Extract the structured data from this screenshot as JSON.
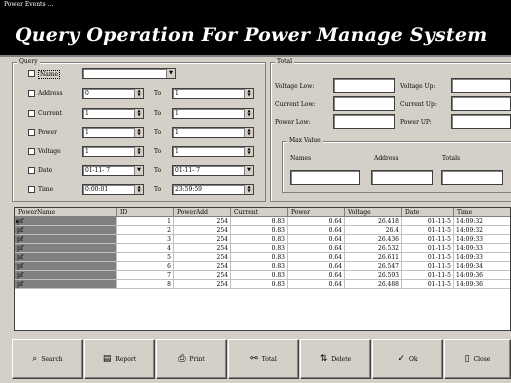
{
  "window": {
    "title": "Power Events ..."
  },
  "banner": {
    "title": "Query Operation For Power Manage System"
  },
  "query": {
    "caption": "Query",
    "to_label": "To",
    "rows": [
      {
        "label": "Name",
        "from": "",
        "to": null
      },
      {
        "label": "Address",
        "from": "0",
        "to": "1"
      },
      {
        "label": "Current",
        "from": "1",
        "to": "1"
      },
      {
        "label": "Power",
        "from": "1",
        "to": "1"
      },
      {
        "label": "Voltage",
        "from": "1",
        "to": "1"
      },
      {
        "label": "Date",
        "from": "01-11- 7",
        "to": "01-11- 7"
      },
      {
        "label": "Time",
        "from": "0:00:01",
        "to": "23:59:59"
      }
    ]
  },
  "total": {
    "caption": "Total",
    "voltage_low_label": "Voltage Low:",
    "current_low_label": "Current Low:",
    "power_low_label": "Power Low:",
    "voltage_up_label": "Voltage Up:",
    "current_up_label": "Current Up:",
    "power_up_label": "Power UP:",
    "max_value": {
      "caption": "Max Value",
      "names_label": "Names",
      "address_label": "Address",
      "totals_label": "Totals"
    }
  },
  "grid": {
    "columns": [
      "PowerName",
      "ID",
      "PowerAdd",
      "Current",
      "Power",
      "Voltage",
      "Date",
      "Time"
    ],
    "rows": [
      [
        "pf",
        "1",
        "254",
        "0.83",
        "0.64",
        "26.418",
        "01-11-5",
        "14:09:32"
      ],
      [
        "pf",
        "2",
        "254",
        "0.83",
        "0.64",
        "26.4",
        "01-11-5",
        "14:09:32"
      ],
      [
        "pf",
        "3",
        "254",
        "0.83",
        "0.64",
        "26.436",
        "01-11-5",
        "14:09:33"
      ],
      [
        "pf",
        "4",
        "254",
        "0.83",
        "0.64",
        "26.532",
        "01-11-5",
        "14:09:33"
      ],
      [
        "pf",
        "5",
        "254",
        "0.83",
        "0.64",
        "26.611",
        "01-11-5",
        "14:09:33"
      ],
      [
        "pf",
        "6",
        "254",
        "0.83",
        "0.64",
        "26.547",
        "01-11-5",
        "14:09:34"
      ],
      [
        "pf",
        "7",
        "254",
        "0.83",
        "0.64",
        "26.593",
        "01-11-5",
        "14:09:36"
      ],
      [
        "pf",
        "8",
        "254",
        "0.83",
        "0.64",
        "26.488",
        "01-11-5",
        "14:09:36"
      ]
    ]
  },
  "buttons": {
    "search": "Search",
    "report": "Report",
    "print": "Print",
    "total": "Total",
    "delete": "Delete",
    "ok": "Ok",
    "close": "Close"
  }
}
